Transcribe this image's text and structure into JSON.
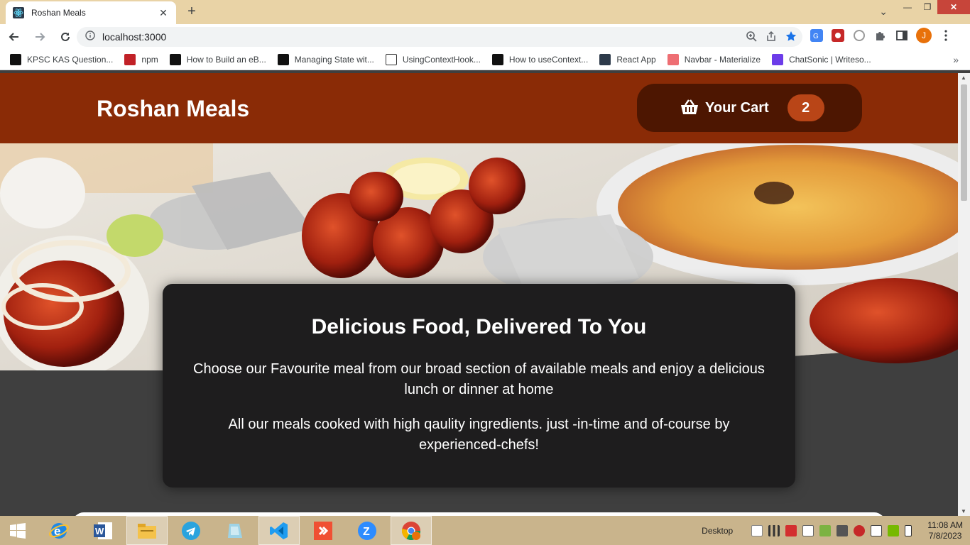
{
  "browser": {
    "tab_title": "Roshan Meals",
    "url": "localhost:3000"
  },
  "bookmarks": [
    {
      "label": "KPSC KAS Question...",
      "color": "#111"
    },
    {
      "label": "npm",
      "color": "#c12127"
    },
    {
      "label": "How to Build an eB...",
      "color": "#111"
    },
    {
      "label": "Managing State wit...",
      "color": "#111"
    },
    {
      "label": "UsingContextHook...",
      "color": "#ffffff"
    },
    {
      "label": "How to useContext...",
      "color": "#111"
    },
    {
      "label": "React App",
      "color": "#2d3a4a"
    },
    {
      "label": "Navbar - Materialize",
      "color": "#ee6e73"
    },
    {
      "label": "ChatSonic | Writeso...",
      "color": "#6c3ce9"
    }
  ],
  "app": {
    "brand": "Roshan Meals",
    "cart_label": "Your Cart",
    "cart_count": "2"
  },
  "summary": {
    "heading": "Delicious Food, Delivered To You",
    "paragraph1": "Choose our Favourite meal from our broad section of available meals and enjoy a delicious lunch or dinner at home",
    "paragraph2": "All our meals cooked with high qaulity ingredients. just -in-time and of-course by experienced-chefs!"
  },
  "taskbar": {
    "desktop_label": "Desktop",
    "time": "11:08 AM",
    "date": "7/8/2023"
  },
  "colors": {
    "header": "#8a2b06",
    "cart_button": "#4d1601",
    "badge": "#b94517",
    "summary_card": "#1e1d1e"
  }
}
